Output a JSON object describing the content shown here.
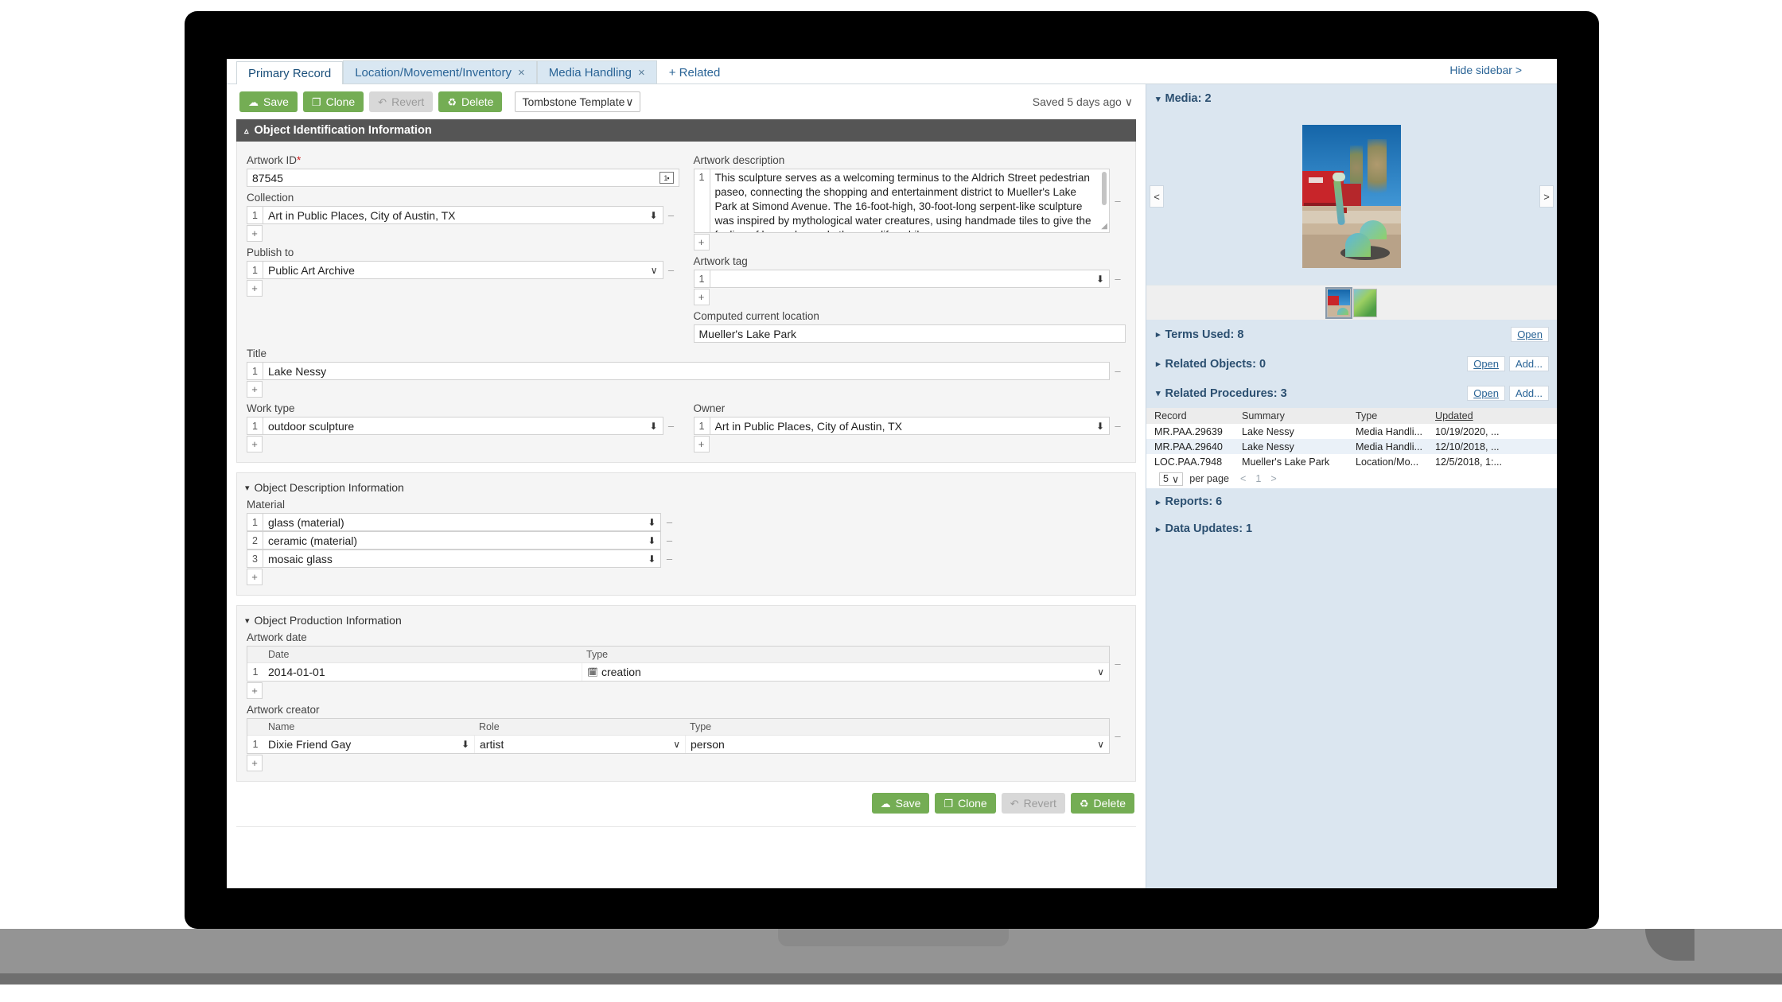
{
  "tabs": [
    {
      "label": "Primary Record",
      "closable": false,
      "active": true
    },
    {
      "label": "Location/Movement/Inventory",
      "closable": true,
      "active": false
    },
    {
      "label": "Media Handling",
      "closable": true,
      "active": false
    },
    {
      "label": "+ Related",
      "closable": false,
      "active": false
    }
  ],
  "hide_sidebar": "Hide sidebar >",
  "toolbar": {
    "save": "Save",
    "clone": "Clone",
    "revert": "Revert",
    "delete": "Delete",
    "template": "Tombstone Template",
    "saved_status": "Saved 5 days ago"
  },
  "sections": {
    "identification": "Object Identification Information",
    "description": "Object Description Information",
    "production": "Object Production Information"
  },
  "fields": {
    "artwork_id_label": "Artwork ID",
    "artwork_id_value": "87545",
    "collection_label": "Collection",
    "collection_value": "Art in Public Places, City of Austin, TX",
    "publish_to_label": "Publish to",
    "publish_to_value": "Public Art Archive",
    "title_label": "Title",
    "title_value": "Lake Nessy",
    "work_type_label": "Work type",
    "work_type_value": "outdoor sculpture",
    "owner_label": "Owner",
    "owner_value": "Art in Public Places, City of Austin, TX",
    "artwork_description_label": "Artwork description",
    "artwork_description_value": "This sculpture serves as a welcoming terminus to the Aldrich Street pedestrian paseo, connecting the shopping and entertainment district to Mueller's Lake Park at Simond Avenue. The 16-foot-high, 30-foot-long serpent-like sculpture was inspired by mythological water creatures, using handmade tiles to give the feeling of barnacles and other sea life, while",
    "artwork_tag_label": "Artwork tag",
    "artwork_tag_value": "",
    "computed_location_label": "Computed current location",
    "computed_location_value": "Mueller's Lake Park",
    "material_label": "Material",
    "materials": [
      "glass (material)",
      "ceramic (material)",
      "mosaic glass"
    ],
    "artwork_date_label": "Artwork date",
    "date_headers": [
      "Date",
      "Type"
    ],
    "artwork_dates": [
      {
        "date": "2014-01-01",
        "type": "creation"
      }
    ],
    "artwork_creator_label": "Artwork creator",
    "creator_headers": [
      "Name",
      "Role",
      "Type"
    ],
    "artwork_creators": [
      {
        "name": "Dixie Friend Gay",
        "role": "artist",
        "type": "person"
      }
    ],
    "row_number": "1",
    "add_symbol": "+",
    "remove_symbol": "–"
  },
  "sidebar": {
    "media_title": "Media: 2",
    "prev_arrow": "<",
    "next_arrow": ">",
    "terms_used": "Terms Used: 8",
    "terms_open": "Open",
    "related_objects": "Related Objects: 0",
    "related_objects_open": "Open",
    "related_objects_add": "Add...",
    "related_procedures": "Related Procedures: 3",
    "related_procedures_open": "Open",
    "related_procedures_add": "Add...",
    "proc_headers": [
      "Record",
      "Summary",
      "Type",
      "Updated"
    ],
    "procedures": [
      {
        "record": "MR.PAA.29639",
        "summary": "Lake Nessy",
        "type": "Media Handli...",
        "updated": "10/19/2020, ..."
      },
      {
        "record": "MR.PAA.29640",
        "summary": "Lake Nessy",
        "type": "Media Handli...",
        "updated": "12/10/2018, ..."
      },
      {
        "record": "LOC.PAA.7948",
        "summary": "Mueller's Lake Park",
        "type": "Location/Mo...",
        "updated": "12/5/2018, 1:..."
      }
    ],
    "per_page_value": "5",
    "per_page_label": "per page",
    "page_prev": "<",
    "page_number": "1",
    "page_next": ">",
    "reports": "Reports: 6",
    "data_updates": "Data Updates: 1"
  },
  "icons": {
    "save": "☁",
    "clone": "❐",
    "revert": "↶",
    "delete": "Ὕ1",
    "chevron_down": "∨",
    "arrow_down": "⬇",
    "caret_up": "⌃",
    "caret_down": "▾",
    "caret_right": "▸",
    "calendar": "Ὄ5"
  }
}
